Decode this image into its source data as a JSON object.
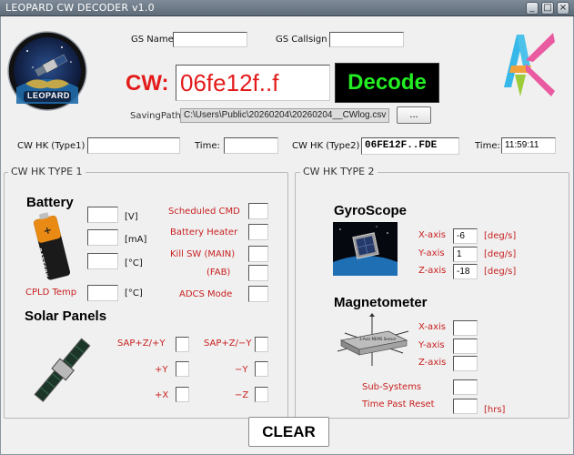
{
  "window": {
    "title": "LEOPARD CW DECODER v1.0",
    "controls": {
      "minimize": "_",
      "maximize": "□",
      "close": "×"
    }
  },
  "header": {
    "gs_name_label": "GS Name",
    "gs_name_value": "",
    "gs_callsign_label": "GS Callsign",
    "gs_callsign_value": "",
    "cw_label": "CW:",
    "cw_value": "06fe12f..f",
    "decode_label": "Decode",
    "saving_path_label": "SavingPath",
    "saving_path_value": "C:\\Users\\Public\\20260204\\20260204__CWlog.csv",
    "browse_label": "...",
    "mission_logo_text": "LEOPARD",
    "colors": {
      "cw_red": "#e31b1b",
      "decode_bg": "#000000",
      "decode_text": "#22ee22"
    }
  },
  "hk_row": {
    "type1_label": "CW HK (Type1)",
    "type1_value": "",
    "time1_label": "Time:",
    "time1_value": "",
    "type2_label": "CW HK (Type2)",
    "type2_value": "06FE12F..FDE",
    "time2_label": "Time:",
    "time2_value": "11:59:11"
  },
  "type1": {
    "title": "CW HK TYPE 1",
    "battery": {
      "heading": "Battery",
      "units": [
        "[V]",
        "[mA]",
        "[°C]"
      ],
      "values": [
        "",
        "",
        ""
      ],
      "cpld_label": "CPLD Temp",
      "cpld_unit": "[°C]",
      "cpld_value": "",
      "image_text": "BATTERY"
    },
    "status": {
      "labels": [
        "Scheduled CMD",
        "Battery Heater",
        "Kill SW (MAIN)",
        "(FAB)",
        "ADCS Mode"
      ],
      "values": [
        "",
        "",
        "",
        "",
        ""
      ]
    },
    "solar": {
      "heading": "Solar Panels",
      "left_labels": [
        "SAP+Z/+Y",
        "+Y",
        "+X"
      ],
      "right_labels": [
        "SAP+Z/−Y",
        "−Y",
        "−Z"
      ],
      "left_values": [
        "",
        "",
        ""
      ],
      "right_values": [
        "",
        "",
        ""
      ]
    }
  },
  "type2": {
    "title": "CW HK TYPE 2",
    "gyro": {
      "heading": "GyroScope",
      "axes": [
        "X-axis",
        "Y-axis",
        "Z-axis"
      ],
      "values": [
        "-6",
        "1",
        "-18"
      ],
      "unit": "[deg/s]"
    },
    "mag": {
      "heading": "Magnetometer",
      "axes": [
        "X-axis",
        "Y-axis",
        "Z-axis"
      ],
      "values": [
        "",
        "",
        ""
      ],
      "sensor_text": "3-Axis MEMS Sensor"
    },
    "subsystems_label": "Sub-Systems",
    "subsystems_value": "",
    "time_reset_label": "Time Past Reset",
    "time_reset_value": "",
    "time_reset_unit": "[hrs]"
  },
  "footer": {
    "clear_label": "CLEAR"
  }
}
